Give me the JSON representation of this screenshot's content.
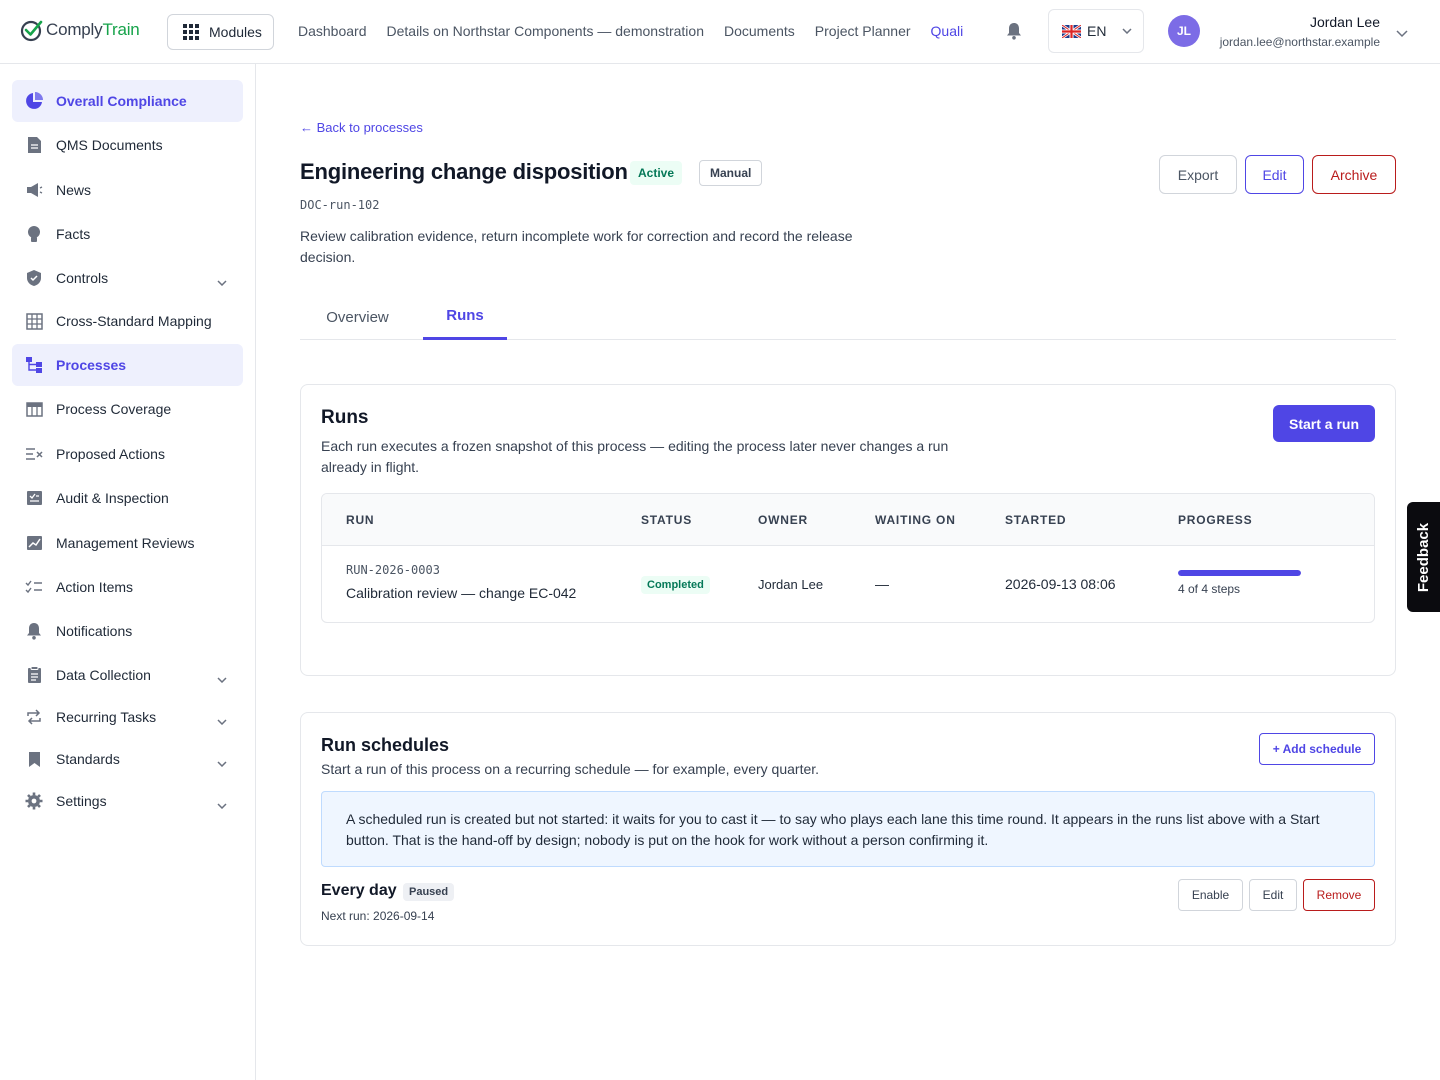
{
  "brand": {
    "name_part1": "Comply",
    "name_part2": "Train"
  },
  "header": {
    "modules_label": "Modules",
    "nav": [
      "Dashboard",
      "Details on Northstar Components — demonstration",
      "Documents",
      "Project Planner",
      "Quali"
    ],
    "language": "EN",
    "user": {
      "initials": "JL",
      "name": "Jordan Lee",
      "email": "jordan.lee@northstar.example"
    }
  },
  "sidebar": {
    "items": [
      {
        "label": "Overall Compliance",
        "icon": "pie-chart-icon",
        "active": true
      },
      {
        "label": "QMS Documents",
        "icon": "document-icon"
      },
      {
        "label": "News",
        "icon": "megaphone-icon"
      },
      {
        "label": "Facts",
        "icon": "lightbulb-icon"
      },
      {
        "label": "Controls",
        "icon": "shield-icon",
        "expandable": true
      },
      {
        "label": "Cross-Standard Mapping",
        "icon": "table-grid-icon"
      },
      {
        "label": "Processes",
        "icon": "process-tree-icon",
        "active": true
      },
      {
        "label": "Process Coverage",
        "icon": "table-icon"
      },
      {
        "label": "Proposed Actions",
        "icon": "list-x-icon"
      },
      {
        "label": "Audit & Inspection",
        "icon": "clipboard-check-icon"
      },
      {
        "label": "Management Reviews",
        "icon": "chart-line-icon"
      },
      {
        "label": "Action Items",
        "icon": "checklist-icon"
      },
      {
        "label": "Notifications",
        "icon": "bell-icon"
      },
      {
        "label": "Data Collection",
        "icon": "clipboard-icon",
        "expandable": true
      },
      {
        "label": "Recurring Tasks",
        "icon": "repeat-icon",
        "expandable": true
      },
      {
        "label": "Standards",
        "icon": "bookmark-icon",
        "expandable": true
      },
      {
        "label": "Settings",
        "icon": "gear-icon",
        "expandable": true
      }
    ]
  },
  "page": {
    "back_link": "← Back to processes",
    "title": "Engineering change disposition",
    "status_badge": "Active",
    "mode_badge": "Manual",
    "doc_id": "DOC-run-102",
    "description": "Review calibration evidence, return incomplete work for correction and record the release decision.",
    "actions": {
      "export": "Export",
      "edit": "Edit",
      "archive": "Archive"
    },
    "tabs": [
      "Overview",
      "Runs"
    ],
    "active_tab": "Runs"
  },
  "runs": {
    "title": "Runs",
    "description": "Each run executes a frozen snapshot of this process — editing the process later never changes a run already in flight.",
    "start_button": "Start a run",
    "columns": [
      "RUN",
      "STATUS",
      "OWNER",
      "WAITING ON",
      "STARTED",
      "PROGRESS"
    ],
    "rows": [
      {
        "id": "RUN-2026-0003",
        "name": "Calibration review — change EC-042",
        "status": "Completed",
        "owner": "Jordan Lee",
        "waiting_on": "—",
        "started": "2026-09-13 08:06",
        "progress_text": "4 of 4 steps",
        "progress_fraction": 1.0
      }
    ]
  },
  "schedules": {
    "title": "Run schedules",
    "description": "Start a run of this process on a recurring schedule — for example, every quarter.",
    "add_button": "+ Add schedule",
    "info": "A scheduled run is created but not started: it waits for you to cast it — to say who plays each lane this time round. It appears in the runs list above with a Start button. That is the hand-off by design; nobody is put on the hook for work without a person confirming it.",
    "items": [
      {
        "name": "Every day",
        "status": "Paused",
        "next_run": "Next run: 2026-09-14",
        "enable": "Enable",
        "edit": "Edit",
        "remove": "Remove"
      }
    ]
  },
  "feedback_label": "Feedback",
  "colors": {
    "accent": "#4f46e5",
    "success": "#047857",
    "danger": "#b91c1c",
    "brand_green": "#16a34a"
  }
}
